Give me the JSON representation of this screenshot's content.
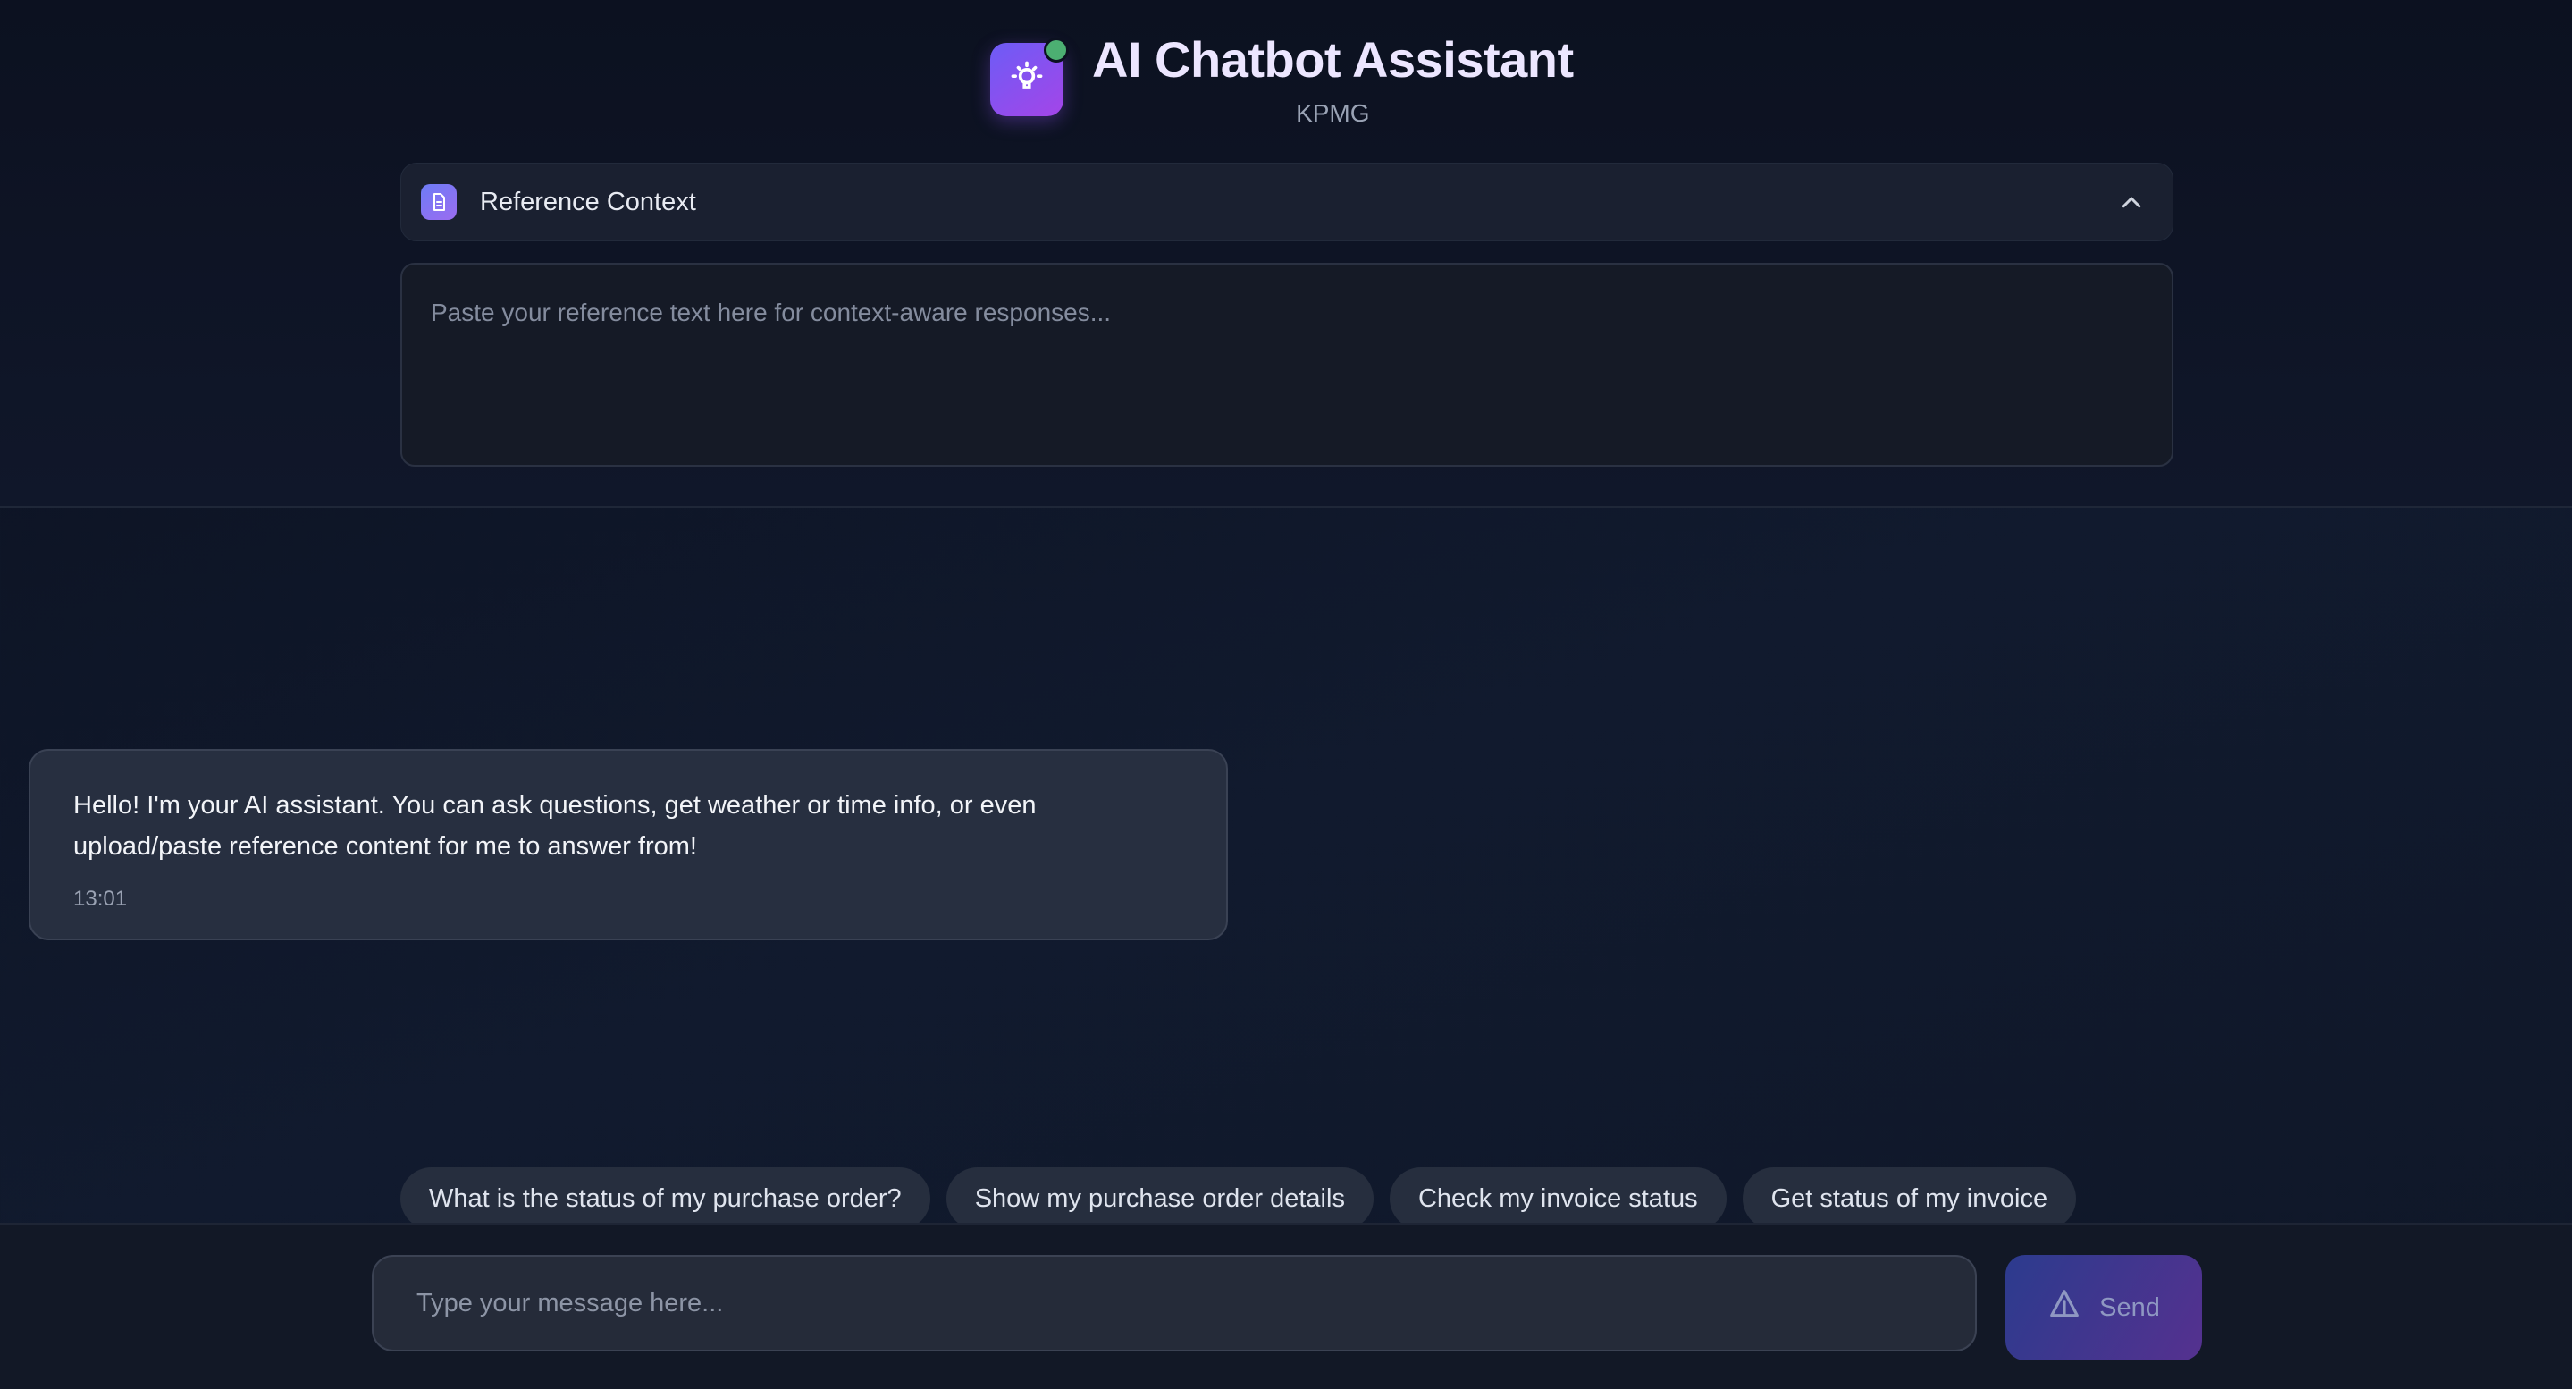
{
  "header": {
    "title": "AI Chatbot Assistant",
    "subtitle": "KPMG",
    "logo_icon": "lightbulb-icon",
    "status_color": "#4caf72"
  },
  "reference": {
    "label": "Reference Context",
    "icon": "document-icon",
    "toggle_icon": "chevron-up-icon",
    "placeholder": "Paste your reference text here for context-aware responses..."
  },
  "chat": {
    "messages": [
      {
        "role": "assistant",
        "text": "Hello! I'm your AI assistant. You can ask questions, get weather or time info, or even upload/paste reference content for me to answer from!",
        "time": "13:01"
      }
    ]
  },
  "suggestions": [
    "What is the status of my purchase order?",
    "Show my purchase order details",
    "Check my invoice status",
    "Get status of my invoice"
  ],
  "composer": {
    "placeholder": "Type your message here...",
    "send_label": "Send",
    "send_icon": "send-icon"
  },
  "colors": {
    "accent_start": "#6d5cf6",
    "accent_end": "#a445e8",
    "background": "#0f1728"
  }
}
